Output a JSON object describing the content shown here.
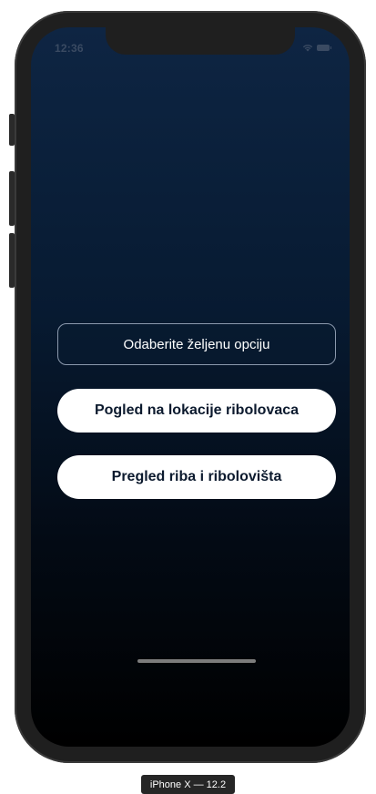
{
  "status_bar": {
    "time": "12:36",
    "wifi_icon": "wifi-icon",
    "battery_icon": "battery-icon"
  },
  "main": {
    "prompt": "Odaberite željenu opciju",
    "options": [
      {
        "label": "Pogled na lokacije ribolovaca"
      },
      {
        "label": "Pregled riba i ribolovišta"
      }
    ]
  },
  "simulator": {
    "device_label": "iPhone X — 12.2"
  },
  "colors": {
    "background_top": "#0e2543",
    "background_bottom": "#000000",
    "button_bg": "#ffffff",
    "button_text": "#0c1a2e",
    "prompt_border": "#8b99ad"
  }
}
